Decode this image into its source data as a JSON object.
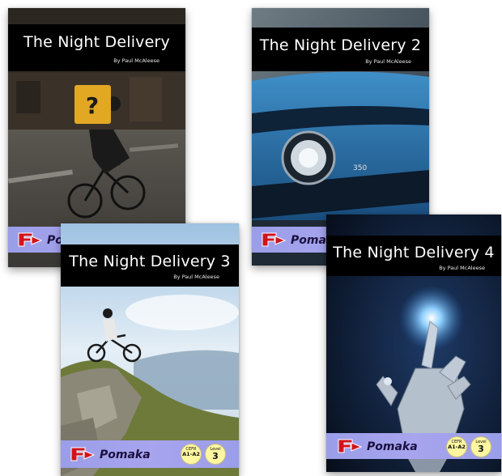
{
  "covers": [
    {
      "title": "The Night Delivery",
      "author": "By Paul McAleese",
      "brand": "Pomaka"
    },
    {
      "title": "The Night Delivery 2",
      "author": "By Paul McAleese",
      "brand": "Pomaka"
    },
    {
      "title": "The Night Delivery 3",
      "author": "By Paul McAleese",
      "brand": "Pomaka",
      "cefr_label": "CEFR",
      "cefr_value": "A1-A2",
      "level_label": "Level",
      "level_value": "3"
    },
    {
      "title": "The Night Delivery 4",
      "author": "By Paul McAleese",
      "brand": "Pomaka",
      "cefr_label": "CEFR",
      "cefr_value": "A1-A2",
      "level_label": "Level",
      "level_value": "3"
    }
  ],
  "colors": {
    "title_band": "#000000",
    "footer_band": "#a0a2ec",
    "logo_red": "#d0141c",
    "badge_yellow": "#fff7a0"
  }
}
